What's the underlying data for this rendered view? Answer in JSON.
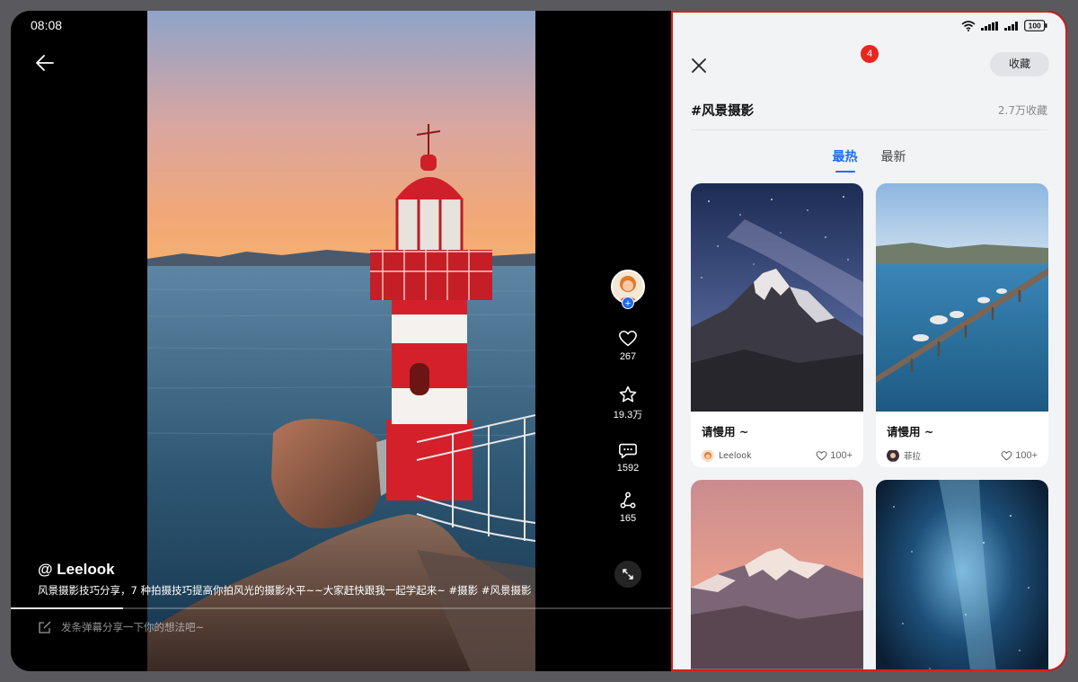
{
  "status_bar": {
    "time": "08:08",
    "battery": "100"
  },
  "video": {
    "author": "@ Leelook",
    "caption": "风景摄影技巧分享，7 种拍摄技巧提高你拍风光的摄影水平~~大家赶快跟我一起学起来~ #摄影 #风景摄影",
    "progress_fraction": 0.17,
    "danmaku_placeholder": "发条弹幕分享一下你的想法吧~",
    "actions": {
      "likes": "267",
      "favorites": "19.3万",
      "comments": "1592",
      "shares": "165"
    }
  },
  "panel": {
    "notification_count": "4",
    "collect_label": "收藏",
    "topic_title": "#风景摄影",
    "topic_count": "2.7万收藏",
    "tabs": [
      {
        "label": "最热",
        "active": true
      },
      {
        "label": "最新",
        "active": false
      }
    ],
    "cards": [
      {
        "title": "请慢用 ~",
        "user": "Leelook",
        "likes": "100+",
        "image": "starry-mountain"
      },
      {
        "title": "请慢用 ~",
        "user": "菲拉",
        "likes": "100+",
        "image": "pier-seagulls"
      },
      {
        "title": "",
        "user": "",
        "likes": "",
        "image": "sunset-mountain"
      },
      {
        "title": "",
        "user": "",
        "likes": "",
        "image": "milky-way"
      }
    ]
  },
  "colors": {
    "accent": "#1e6cf4",
    "badge": "#e8261f",
    "panel_border": "#d81e1e",
    "lighthouse_red": "#d4202a"
  }
}
